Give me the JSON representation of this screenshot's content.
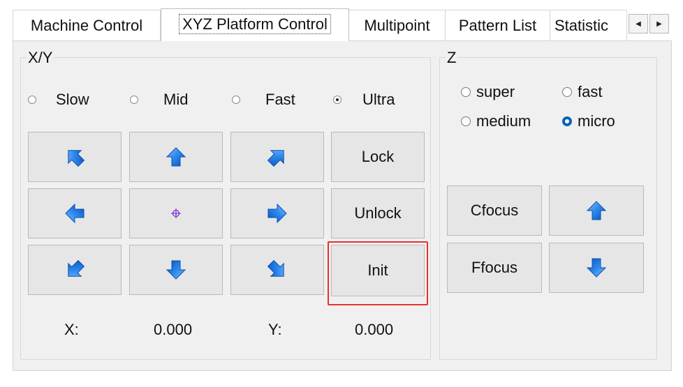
{
  "tabs": {
    "items": [
      {
        "label": "Machine Control"
      },
      {
        "label": "XYZ Platform Control"
      },
      {
        "label": "Multipoint"
      },
      {
        "label": "Pattern List"
      },
      {
        "label": "Statistic"
      }
    ],
    "active_index": 1,
    "scroll_left_icon": "triangle-left-icon",
    "scroll_right_icon": "triangle-right-icon"
  },
  "xy": {
    "legend": "X/Y",
    "speeds": [
      {
        "label": "Slow",
        "checked": false
      },
      {
        "label": "Mid",
        "checked": false
      },
      {
        "label": "Fast",
        "checked": false
      },
      {
        "label": "Ultra",
        "checked": true
      }
    ],
    "buttons": {
      "up_left_icon": "arrow-up-left-icon",
      "up_icon": "arrow-up-icon",
      "up_right_icon": "arrow-up-right-icon",
      "left_icon": "arrow-left-icon",
      "center_icon": "crosshair-icon",
      "right_icon": "arrow-right-icon",
      "down_left_icon": "arrow-down-left-icon",
      "down_icon": "arrow-down-icon",
      "down_right_icon": "arrow-down-right-icon",
      "lock": "Lock",
      "unlock": "Unlock",
      "init": "Init"
    },
    "x_label": "X:",
    "x_value": "0.000",
    "y_label": "Y:",
    "y_value": "0.000"
  },
  "z": {
    "legend": "Z",
    "speeds": [
      {
        "label": "super",
        "checked": false
      },
      {
        "label": "fast",
        "checked": false
      },
      {
        "label": "medium",
        "checked": false
      },
      {
        "label": "micro",
        "checked": true
      }
    ],
    "buttons": {
      "cfocus": "Cfocus",
      "ffocus": "Ffocus",
      "up_icon": "arrow-up-icon",
      "down_icon": "arrow-down-icon"
    }
  },
  "colors": {
    "arrow_blue": "#1f74d6",
    "radio_selected": "#0a64b8",
    "highlight_red": "#e3332f",
    "crosshair_purple": "#7a2fd0"
  }
}
